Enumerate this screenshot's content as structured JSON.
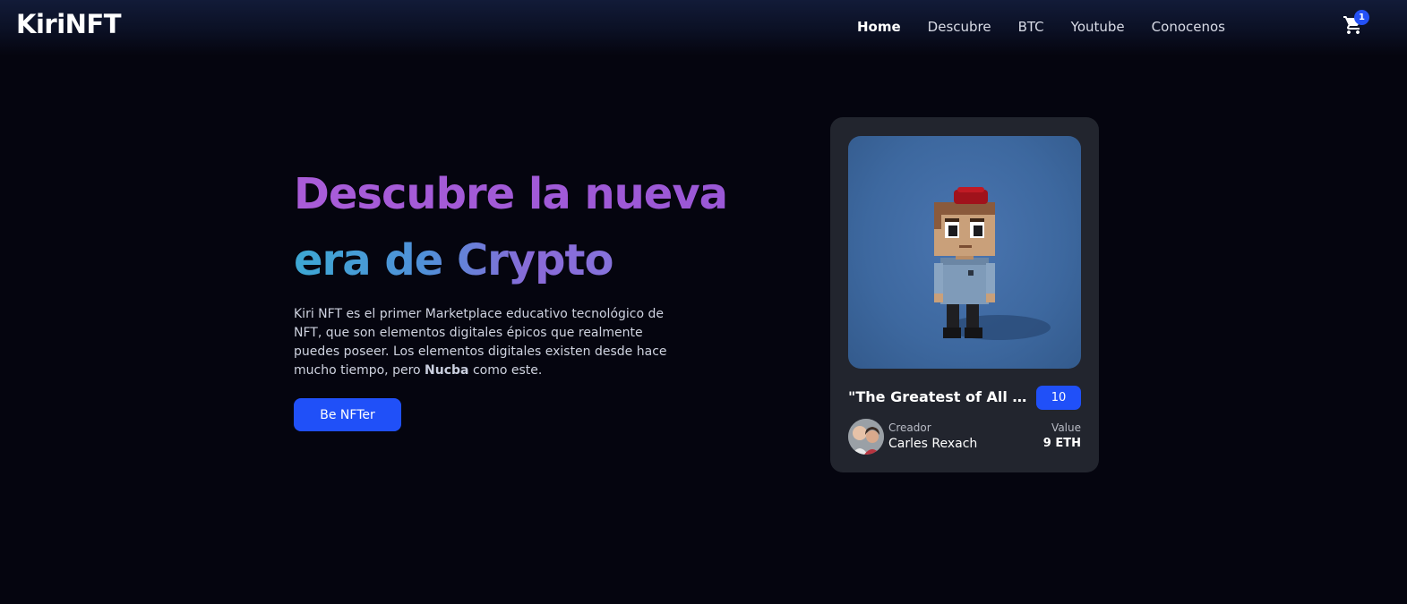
{
  "nav": {
    "logo": "KiriNFT",
    "links": [
      "Home",
      "Descubre",
      "BTC",
      "Youtube",
      "Conocenos"
    ],
    "active": "Home",
    "cart_icon": "shopping-cart-icon",
    "cart_count": "1"
  },
  "hero": {
    "title_line1": "Descubre la nueva",
    "title_line2": "era de Crypto",
    "desc_part1": "Kiri NFT es el primer Marketplace educativo tecnológico de NFT, que son elementos digitales épicos que realmente puedes poseer. Los elementos digitales existen desde hace mucho tiempo, pero ",
    "desc_bold": "Nucba",
    "desc_part2": " como este.",
    "cta_label": "Be NFTer"
  },
  "card": {
    "title": "\"The Greatest of All Time\"",
    "count": "10",
    "creator_label": "Creador",
    "creator_name": "Carles Rexach",
    "value_label": "Value",
    "value_amount": "9 ETH"
  },
  "colors": {
    "background": "#05050f",
    "accent": "#2050f8",
    "card_bg": "#22252e",
    "title_purple": "#a95cd8",
    "title_blue": "#3da8d4"
  }
}
